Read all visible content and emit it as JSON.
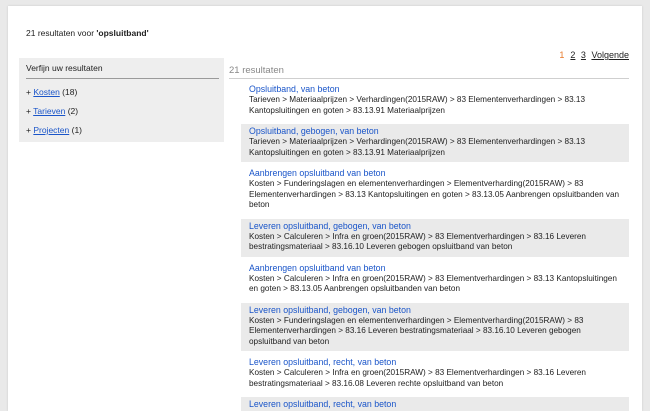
{
  "summary": {
    "prefix": "21 resultaten voor ",
    "query": "'opsluitband'"
  },
  "pager": {
    "current": "1",
    "page2": "2",
    "page3": "3",
    "next": "Volgende"
  },
  "sidebar": {
    "title": "Verfijn uw resultaten",
    "facets": [
      {
        "label": "Kosten",
        "count": "(18)"
      },
      {
        "label": "Tarieven",
        "count": "(2)"
      },
      {
        "label": "Projecten",
        "count": "(1)"
      }
    ]
  },
  "results_count": "21 resultaten",
  "results": [
    {
      "title": "Opsluitband, van beton",
      "path": "Tarieven > Materiaalprijzen > Verhardingen(2015RAW) > 83 Elementenverhardingen > 83.13 Kantopsluitingen en goten > 83.13.91 Materiaalprijzen"
    },
    {
      "title": "Opsluitband, gebogen, van beton",
      "path": "Tarieven > Materiaalprijzen > Verhardingen(2015RAW) > 83 Elementenverhardingen > 83.13 Kantopsluitingen en goten > 83.13.91 Materiaalprijzen"
    },
    {
      "title": "Aanbrengen opsluitband van beton",
      "path": "Kosten > Funderingslagen en elementenverhardingen > Elementverharding(2015RAW) > 83 Elementenverhardingen > 83.13 Kantopsluitingen en goten > 83.13.05 Aanbrengen opsluitbanden van beton"
    },
    {
      "title": "Leveren opsluitband, gebogen, van beton",
      "path": "Kosten > Calculeren > Infra en groen(2015RAW) > 83 Elementverhardingen > 83.16 Leveren bestratingsmateriaal > 83.16.10 Leveren gebogen opsluitband van beton"
    },
    {
      "title": "Aanbrengen opsluitband van beton",
      "path": "Kosten > Calculeren > Infra en groen(2015RAW) > 83 Elementverhardingen > 83.13 Kantopsluitingen en goten > 83.13.05 Aanbrengen opsluitbanden van beton"
    },
    {
      "title": "Leveren opsluitband, gebogen, van beton",
      "path": "Kosten > Funderingslagen en elementenverhardingen > Elementverharding(2015RAW) > 83 Elementenverhardingen > 83.16 Leveren bestratingsmateriaal > 83.16.10 Leveren gebogen opsluitband van beton"
    },
    {
      "title": "Leveren opsluitband, recht, van beton",
      "path": "Kosten > Calculeren > Infra en groen(2015RAW) > 83 Elementverhardingen > 83.16 Leveren bestratingsmateriaal > 83.16.08 Leveren rechte opsluitband van beton"
    },
    {
      "title": "Leveren opsluitband, recht, van beton",
      "path": ""
    }
  ]
}
